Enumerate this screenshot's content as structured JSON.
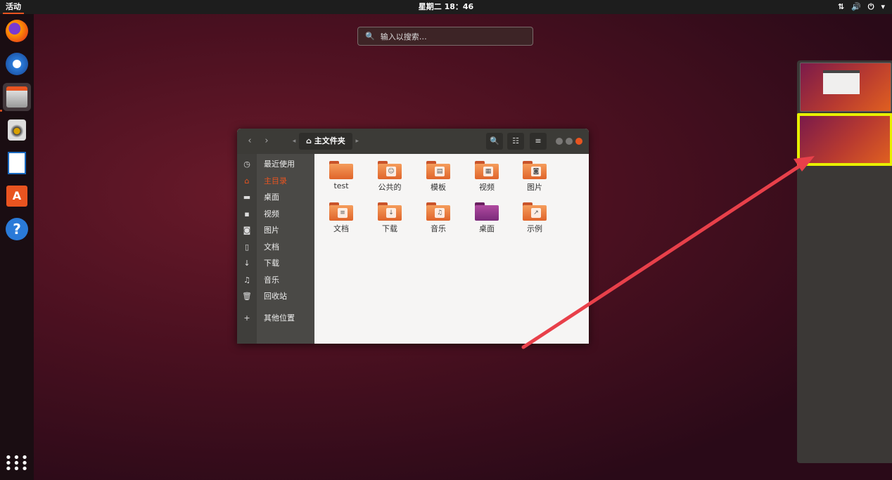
{
  "topbar": {
    "activities": "活动",
    "clock": "星期二 18：46",
    "tray_icons": [
      "network-icon",
      "volume-icon",
      "power-icon",
      "dropdown-icon"
    ]
  },
  "search": {
    "placeholder": "输入以搜索…"
  },
  "dock": {
    "items": [
      "firefox-icon",
      "thunderbird-icon",
      "files-icon",
      "rhythmbox-icon",
      "libreoffice-writer-icon",
      "software-center-icon",
      "help-icon"
    ],
    "show_apps_icon": "grid-icon"
  },
  "file_manager": {
    "path_label": "主文件夹",
    "sidebar": [
      {
        "icon": "clock-icon",
        "label": "最近使用"
      },
      {
        "icon": "home-icon",
        "label": "主目录",
        "selected": true
      },
      {
        "icon": "folder-icon",
        "label": "桌面"
      },
      {
        "icon": "video-icon",
        "label": "视频"
      },
      {
        "icon": "camera-icon",
        "label": "图片"
      },
      {
        "icon": "document-icon",
        "label": "文档"
      },
      {
        "icon": "download-icon",
        "label": "下载"
      },
      {
        "icon": "music-icon",
        "label": "音乐"
      },
      {
        "icon": "trash-icon",
        "label": "回收站"
      },
      {
        "icon": "plus-icon",
        "label": "其他位置"
      }
    ],
    "files": [
      {
        "label": "test",
        "icon": "folder-icon"
      },
      {
        "label": "公共的",
        "icon": "public-folder-icon"
      },
      {
        "label": "模板",
        "icon": "templates-folder-icon"
      },
      {
        "label": "视频",
        "icon": "videos-folder-icon"
      },
      {
        "label": "图片",
        "icon": "pictures-folder-icon"
      },
      {
        "label": "文档",
        "icon": "documents-folder-icon"
      },
      {
        "label": "下载",
        "icon": "downloads-folder-icon"
      },
      {
        "label": "音乐",
        "icon": "music-folder-icon"
      },
      {
        "label": "桌面",
        "icon": "desktop-folder-icon"
      },
      {
        "label": "示例",
        "icon": "examples-folder-icon"
      }
    ]
  },
  "colors": {
    "accent": "#e95420",
    "highlight": "#e8f000",
    "arrow": "#e8404a"
  }
}
